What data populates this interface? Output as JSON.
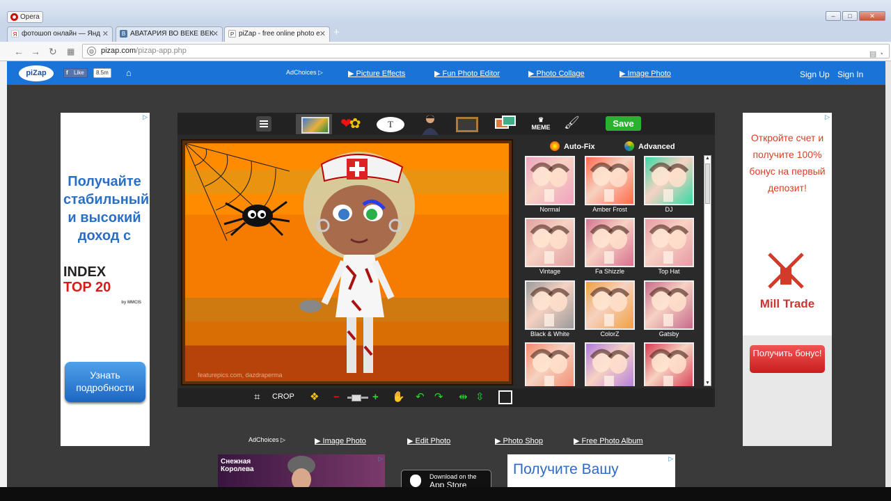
{
  "browser": {
    "app_label": "Opera",
    "tabs": [
      {
        "title": "фотошоп онлайн — Янд",
        "favicon": "Я",
        "active": false
      },
      {
        "title": "АВАТАРИЯ ВО ВЕКЕ ВЕК",
        "favicon": "В",
        "active": false
      },
      {
        "title": "piZap - free online photo e",
        "favicon": "P",
        "active": true
      }
    ],
    "url_host": "pizap.com",
    "url_path": "/pizap-app.php"
  },
  "site_nav": {
    "logo": "piZap",
    "fb_like": "Like",
    "fb_count": "8.5m",
    "adchoices": "AdChoices",
    "links": [
      "▶ Picture Effects",
      "▶ Fun Photo Editor",
      "▶ Photo Collage",
      "▶ Image Photo"
    ],
    "sign_up": "Sign Up",
    "sign_in": "Sign In"
  },
  "ad_left": {
    "headline": "Получайте стабильный и высокий доход с",
    "logo_main": "INDEX",
    "logo_sub": "TOP 20",
    "logo_tag": "by MMCIS",
    "button": "Узнать подробности"
  },
  "ad_right": {
    "headline": "Откройте счет и получите 100% бонус на первый депозит!",
    "brand": "Mill Trade",
    "button": "Получить бонус!"
  },
  "editor": {
    "toolbar": {
      "text_tool": "T",
      "meme_label": "MEME",
      "save": "Save"
    },
    "watermark": "featurepics.com, dazdraperma",
    "filter_tabs": {
      "auto_fix": "Auto-Fix",
      "advanced": "Advanced"
    },
    "filters": [
      {
        "name": "Normal",
        "tint": "#f0a0c0"
      },
      {
        "name": "Amber Frost",
        "tint": "#ff6a4a"
      },
      {
        "name": "DJ",
        "tint": "#39d9a5"
      },
      {
        "name": "Vintage",
        "tint": "#e0a0a0"
      },
      {
        "name": "Fa Shizzle",
        "tint": "#d87090"
      },
      {
        "name": "Top Hat",
        "tint": "#e89aa6"
      },
      {
        "name": "Black & White",
        "tint": "#9a9a9a"
      },
      {
        "name": "ColorZ",
        "tint": "#f0a040"
      },
      {
        "name": "Gatsby",
        "tint": "#c86a8a"
      },
      {
        "name": "",
        "tint": "#f28a6a"
      },
      {
        "name": "",
        "tint": "#b07ae0"
      },
      {
        "name": "",
        "tint": "#d83a50"
      }
    ],
    "bottom_bar": {
      "crop": "CROP"
    }
  },
  "footer": {
    "adchoices": "AdChoices",
    "links": [
      "▶ Image Photo",
      "▶ Edit Photo",
      "▶ Photo Shop",
      "▶ Free Photo Album"
    ]
  },
  "ad_bottom_left": {
    "logo": "Снежная Королева"
  },
  "app_store": {
    "line1": "Download on the",
    "line2": "App Store"
  },
  "ad_bottom_right": {
    "text": "Получите Вашу"
  },
  "colors": {
    "nav_blue": "#1a73d6",
    "save_green": "#2ab12f",
    "canvas_orange": "#ff8c00"
  }
}
